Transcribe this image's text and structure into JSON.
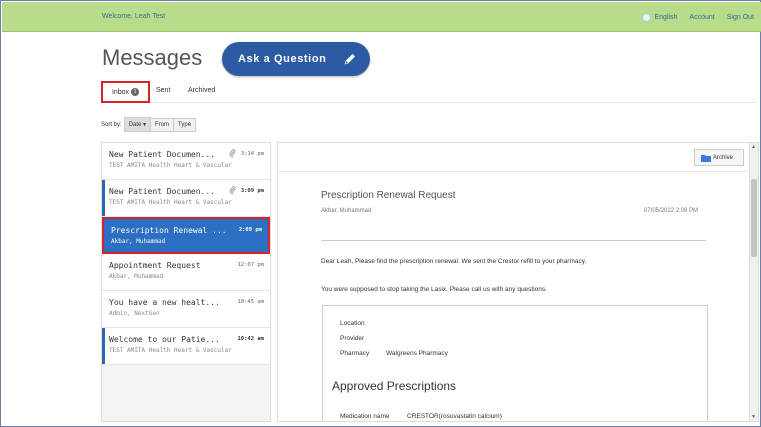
{
  "topbar": {
    "welcome": "Welcome, Leah Test",
    "language": "English",
    "account": "Account",
    "signout": "Sign Out"
  },
  "page_title": "Messages",
  "ask_button": "Ask a Question",
  "tabs": {
    "inbox": "Inbox",
    "inbox_count": "1",
    "sent": "Sent",
    "archived": "Archived"
  },
  "sort": {
    "label": "Sort by:",
    "date": "Date ▾",
    "from": "From",
    "type": "Type"
  },
  "messages": [
    {
      "subject": "New Patient Documen...",
      "from": "TEST AMITA Health Heart & Vascular",
      "time": "3:14 pm",
      "attachment": true
    },
    {
      "subject": "New Patient Documen...",
      "from": "TEST AMITA Health Heart & Vascular",
      "time": "3:09 pm",
      "attachment": true
    },
    {
      "subject": "Prescription Renewal ...",
      "from": "Akbar, Muhammad",
      "time": "2:09 pm",
      "attachment": false
    },
    {
      "subject": "Appointment Request",
      "from": "Akbar, Muhammad",
      "time": "12:07 pm",
      "attachment": false
    },
    {
      "subject": "You have a new healt...",
      "from": "Admin, NextGen",
      "time": "10:45 am",
      "attachment": false
    },
    {
      "subject": "Welcome to our Patie...",
      "from": "TEST AMITA Health Heart & Vascular",
      "time": "10:42 am",
      "attachment": false
    }
  ],
  "pane": {
    "archive_button": "Archive",
    "subject": "Prescription Renewal Request",
    "sender": "Akbar, Muhammad",
    "date": "07/05/2022 2:09 PM",
    "line1": "Dear Leah, Please find the prescription renewal. We sent the Crestor refill to your pharmacy.",
    "line2": "You were supposed to stop taking the Lasix. Please call us with any questions.",
    "location_label": "Location",
    "provider_label": "Provider",
    "pharmacy_label": "Pharmacy",
    "pharmacy_value": "Walgreens Pharmacy",
    "approved_heading": "Approved Prescriptions",
    "medication_label": "Medication name",
    "medication_value": "CRESTOR(rosuvastatin calcium)"
  },
  "colors": {
    "topbar": "#b9dc8a",
    "accent": "#2d5ba3",
    "selected": "#2d6fc2",
    "highlight_border": "#d8232a"
  }
}
